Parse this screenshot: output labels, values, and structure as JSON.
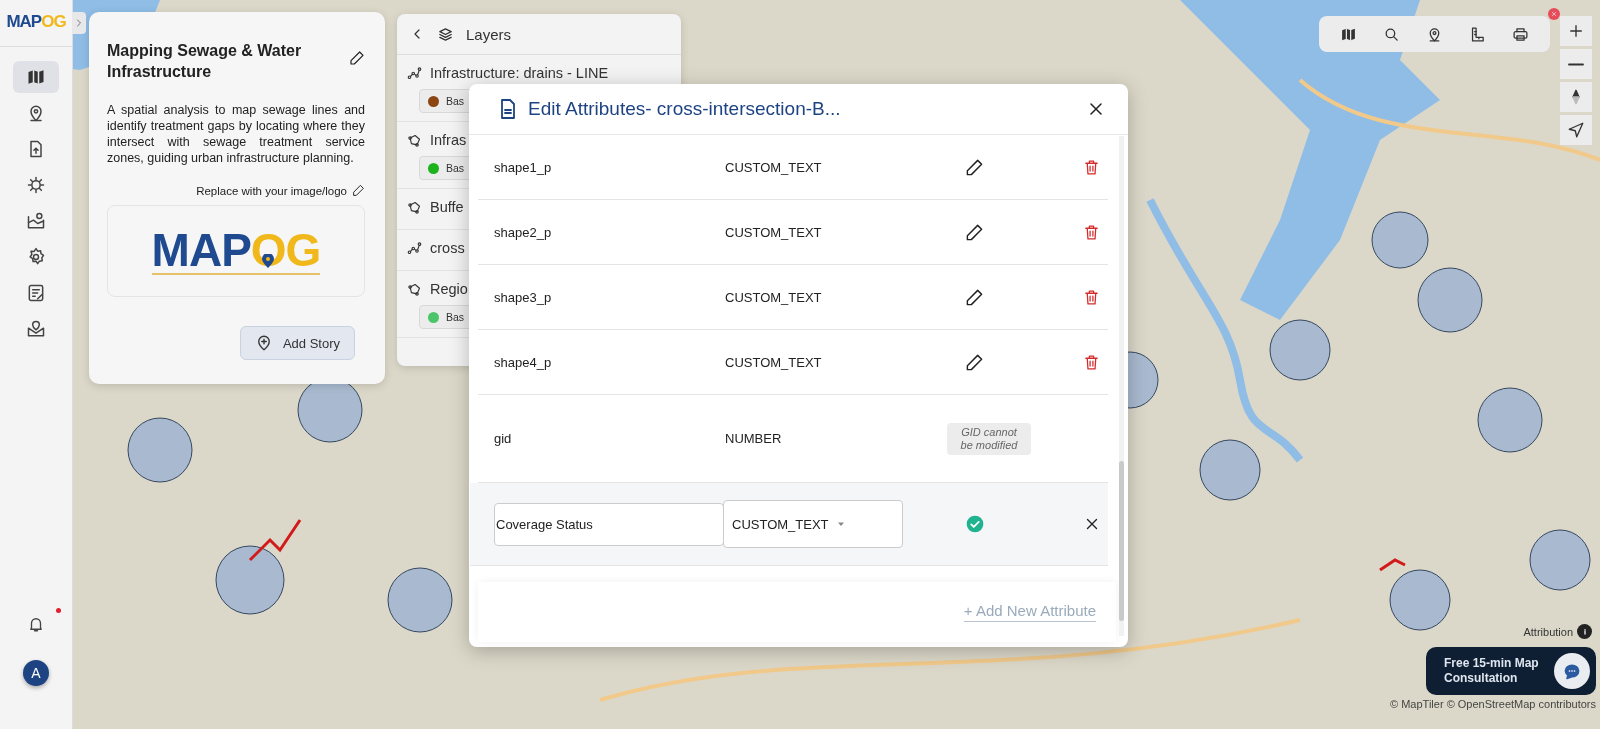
{
  "sidebar": {
    "logo": {
      "primary": "MAP",
      "accent": "OG"
    },
    "nav_items": [
      {
        "selected": true
      },
      {
        "selected": false
      },
      {
        "selected": false
      },
      {
        "selected": false
      },
      {
        "selected": false
      },
      {
        "selected": false
      },
      {
        "selected": false
      },
      {
        "selected": false
      }
    ],
    "notifications": {
      "unread": true
    },
    "avatar": "A"
  },
  "story": {
    "title": "Mapping Sewage & Water Infrastructure",
    "description": "A spatial analysis to map sewage lines and identify treatment gaps by locating where they intersect with sewage treatment service zones, guiding urban infrastructure planning.",
    "logo_hint": "Replace with your image/logo",
    "logo": {
      "primary": "MAP",
      "accent": "OG"
    },
    "add_button": "Add Story"
  },
  "layers": {
    "title": "Layers",
    "items": [
      {
        "kind": "line",
        "name": "Infrastructure: drains - LINE",
        "legend": {
          "label": "Bas",
          "color": "#8b4513"
        }
      },
      {
        "kind": "polygon",
        "name": "Infras",
        "legend": {
          "label": "Bas",
          "color": "#1db31d"
        }
      },
      {
        "kind": "polygon",
        "name": "Buffe"
      },
      {
        "kind": "line",
        "name": "cross"
      },
      {
        "kind": "polygon",
        "name": "Regio",
        "legend": {
          "label": "Bas",
          "color": "#4cc46a"
        }
      }
    ]
  },
  "consultation": "Free 15-min Map Consultation",
  "attribution": {
    "label": "Attribution",
    "credits": "© MapTiler © OpenStreetMap contributors"
  },
  "modal": {
    "title": "Edit Attributes- cross-intersection-B...",
    "attributes": [
      {
        "kind": "editable",
        "name": "shape1_p",
        "type": "CUSTOM_TEXT"
      },
      {
        "kind": "editable",
        "name": "shape2_p",
        "type": "CUSTOM_TEXT"
      },
      {
        "kind": "editable",
        "name": "shape3_p",
        "type": "CUSTOM_TEXT"
      },
      {
        "kind": "editable",
        "name": "shape4_p",
        "type": "CUSTOM_TEXT"
      },
      {
        "kind": "locked",
        "name": "gid",
        "type": "NUMBER",
        "note": "GID cannot be modified"
      }
    ],
    "new_attribute": {
      "name": "Coverage Status",
      "type": "CUSTOM_TEXT"
    },
    "add_link": "+ Add New Attribute"
  }
}
